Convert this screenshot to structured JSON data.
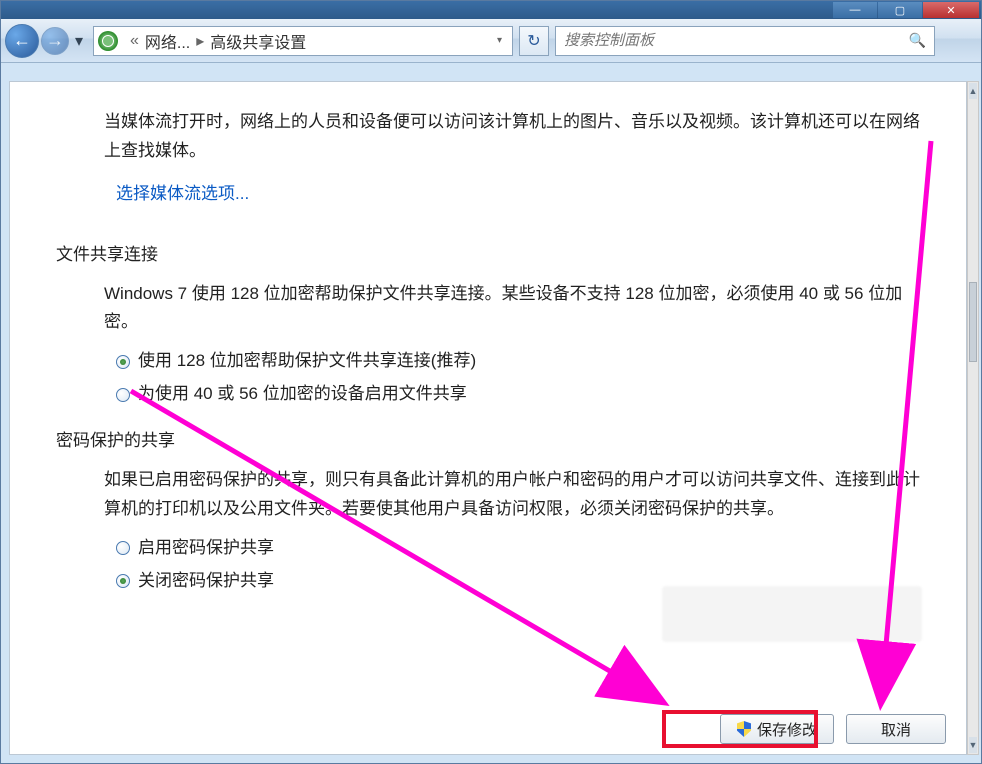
{
  "titlebar": {
    "min_icon": "—",
    "max_icon": "▢",
    "close_icon": "✕"
  },
  "nav": {
    "back_glyph": "←",
    "fwd_glyph": "→",
    "dropdown_glyph": "▾",
    "addr_chevrons": "«",
    "addr_part1": "网络...",
    "addr_sep": "▸",
    "addr_part2": "高级共享设置",
    "addr_drop": "▾",
    "refresh_glyph": "↻",
    "search_placeholder": "搜索控制面板",
    "search_glyph": "🔍"
  },
  "content": {
    "media_desc": "当媒体流打开时，网络上的人员和设备便可以访问该计算机上的图片、音乐以及视频。该计算机还可以在网络上查找媒体。",
    "media_link": "选择媒体流选项...",
    "conn_title": "文件共享连接",
    "conn_desc": "Windows 7 使用 128 位加密帮助保护文件共享连接。某些设备不支持 128 位加密，必须使用 40 或 56 位加密。",
    "conn_opt1": "使用 128 位加密帮助保护文件共享连接(推荐)",
    "conn_opt2": "为使用 40 或 56 位加密的设备启用文件共享",
    "pwd_title": "密码保护的共享",
    "pwd_desc": "如果已启用密码保护的共享，则只有具备此计算机的用户帐户和密码的用户才可以访问共享文件、连接到此计算机的打印机以及公用文件夹。若要使其他用户具备访问权限，必须关闭密码保护的共享。",
    "pwd_opt1": "启用密码保护共享",
    "pwd_opt2": "关闭密码保护共享"
  },
  "buttons": {
    "save": "保存修改",
    "cancel": "取消"
  },
  "scroll": {
    "up": "▲",
    "down": "▼"
  }
}
